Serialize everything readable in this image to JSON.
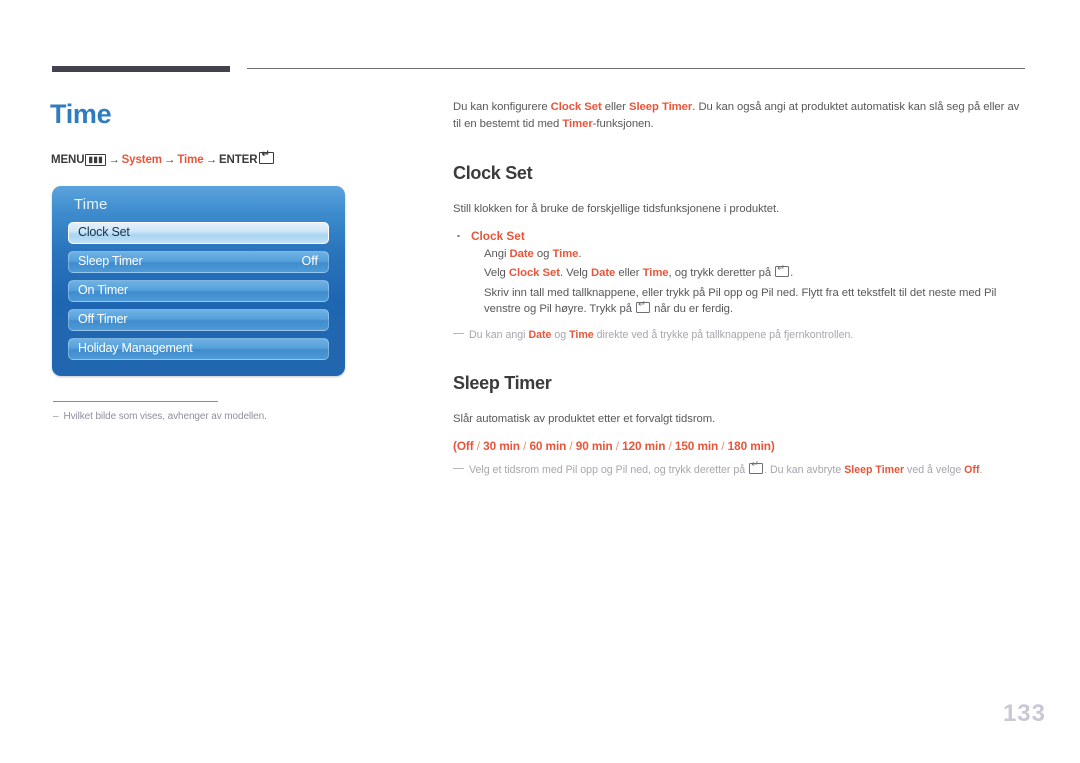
{
  "document": {
    "page_number": "133",
    "page_title": "Time",
    "title_color": "#2e7cbf",
    "accent_color": "#e8553a"
  },
  "breadcrumb": {
    "menu_label": "MENU",
    "menu_icon": "menu-grid-icon",
    "arrow": "→",
    "step_system": "System",
    "step_time": "Time",
    "enter_label": "ENTER",
    "enter_icon": "enter-key-icon"
  },
  "osd": {
    "title": "Time",
    "items": [
      {
        "label": "Clock Set",
        "value": "",
        "selected": true
      },
      {
        "label": "Sleep Timer",
        "value": "Off",
        "selected": false
      },
      {
        "label": "On Timer",
        "value": "",
        "selected": false
      },
      {
        "label": "Off Timer",
        "value": "",
        "selected": false
      },
      {
        "label": "Holiday Management",
        "value": "",
        "selected": false
      }
    ]
  },
  "left_note": {
    "dash": "–",
    "text": "Hvilket bilde som vises, avhenger av modellen."
  },
  "content": {
    "intro": {
      "p1": "Du kan konfigurere ",
      "a1": "Clock Set",
      "p2": " eller ",
      "a2": "Sleep Timer",
      "p3": ". Du kan også angi at produktet automatisk kan slå seg på eller av til en bestemt tid med ",
      "a3": "Timer",
      "p4": "-funksjonen."
    },
    "clock_set": {
      "heading": "Clock Set",
      "lead": "Still klokken for å bruke de forskjellige tidsfunksjonene i produktet.",
      "bullet_title": "Clock Set",
      "line1_p1": "Angi ",
      "line1_a1": "Date",
      "line1_p2": " og ",
      "line1_a2": "Time",
      "line1_p3": ".",
      "line2_p1": "Velg ",
      "line2_a1": "Clock Set",
      "line2_p2": ". Velg ",
      "line2_a2": "Date",
      "line2_p3": " eller ",
      "line2_a3": "Time",
      "line2_p4": ", og trykk deretter på ",
      "line2_p5": ".",
      "line3_p1": "Skriv inn tall med tallknappene, eller trykk på Pil opp og Pil ned. Flytt fra ett tekstfelt til det neste med Pil venstre og Pil høyre. Trykk på ",
      "line3_p2": " når du er ferdig.",
      "note_p1": "Du kan angi ",
      "note_a1": "Date",
      "note_p2": " og ",
      "note_a2": "Time",
      "note_p3": " direkte ved å trykke på tallknappene på fjernkontrollen."
    },
    "sleep_timer": {
      "heading": "Sleep Timer",
      "lead": "Slår automatisk av produktet etter et forvalgt tidsrom.",
      "options_open": "(",
      "options": [
        "Off",
        "30 min",
        "60 min",
        "90 min",
        "120 min",
        "150 min",
        "180 min"
      ],
      "options_sep": " / ",
      "options_close": ")",
      "note_p1": "Velg et tidsrom med Pil opp og Pil ned, og trykk deretter på ",
      "note_p2": ". Du kan avbryte ",
      "note_a1": "Sleep Timer",
      "note_p3": " ved å velge ",
      "note_a2": "Off",
      "note_p4": "."
    }
  }
}
